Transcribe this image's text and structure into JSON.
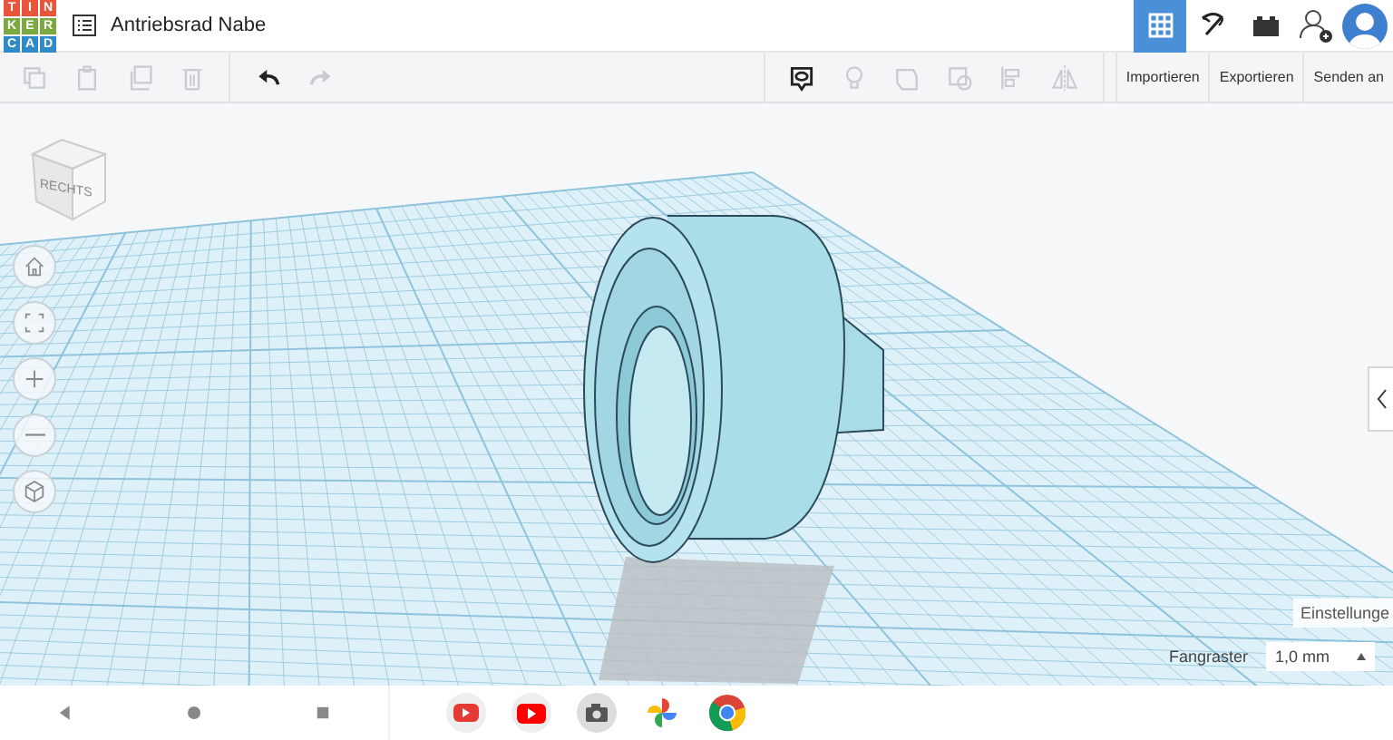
{
  "logo": {
    "rows": [
      [
        "T",
        "I",
        "N"
      ],
      [
        "K",
        "E",
        "R"
      ],
      [
        "C",
        "A",
        "D"
      ]
    ]
  },
  "document": {
    "title": "Antriebsrad Nabe"
  },
  "modes": [
    {
      "kind": "grid",
      "selected": true
    },
    {
      "kind": "pickaxe",
      "selected": false
    },
    {
      "kind": "bricks",
      "selected": false
    }
  ],
  "edit_tools": [
    {
      "kind": "copy",
      "disabled": true
    },
    {
      "kind": "paste",
      "disabled": true
    },
    {
      "kind": "duplicate",
      "disabled": true
    },
    {
      "kind": "delete",
      "disabled": true
    },
    {
      "kind": "undo",
      "disabled": false
    },
    {
      "kind": "redo",
      "disabled": true
    }
  ],
  "shape_tools": [
    {
      "kind": "notes",
      "disabled": false
    },
    {
      "kind": "bulb",
      "disabled": true
    },
    {
      "kind": "group",
      "disabled": true
    },
    {
      "kind": "ungroup",
      "disabled": true
    },
    {
      "kind": "align",
      "disabled": true
    },
    {
      "kind": "mirror",
      "disabled": true
    }
  ],
  "actions": [
    "Importieren",
    "Exportieren",
    "Senden an"
  ],
  "view_cube": {
    "label": "RECHTS"
  },
  "nav_buttons": [
    {
      "kind": "home"
    },
    {
      "kind": "fit"
    },
    {
      "kind": "zoom_in"
    },
    {
      "kind": "zoom_out"
    },
    {
      "kind": "ortho"
    }
  ],
  "settings": {
    "label": "Einstellunge"
  },
  "snap_grid": {
    "label": "Fangraster",
    "value": "1,0 mm"
  },
  "system_nav": [
    {
      "kind": "back"
    },
    {
      "kind": "home"
    },
    {
      "kind": "recents"
    }
  ],
  "dock": [
    {
      "kind": "youtube-studio"
    },
    {
      "kind": "youtube"
    },
    {
      "kind": "camera"
    },
    {
      "kind": "pinwheel"
    },
    {
      "kind": "browser"
    }
  ]
}
